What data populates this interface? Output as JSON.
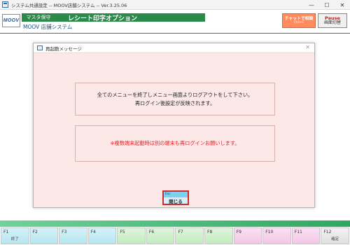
{
  "window": {
    "title": "システム共通設定 -- MOOV店舗システム -- Ver.3.25.06",
    "minimize_glyph": "—",
    "maximize_glyph": "☐",
    "close_glyph": "✕"
  },
  "header": {
    "logo_text": "MOOV",
    "master_label": "マスタ保守",
    "screen_title": "レシート印字オプション",
    "system_name": "MOOV 店舗システム",
    "chat_button": {
      "line1": "チャットで相談",
      "line2": "Ctrl+S"
    },
    "pause_button": {
      "line1": "Pause",
      "line2": "画面切替"
    }
  },
  "dialog": {
    "title": "再起動メッセージ",
    "close_glyph": "✕",
    "message_line1": "全てのメニューを終了しメニュー画面よりログアウトをして下さい。",
    "message_line2": "再ログイン後設定が反映されます。",
    "warning": "※複数端末起動時は別の端末も再ログインお願いします。",
    "close_button": {
      "key": "Esc",
      "label": "閉じる"
    }
  },
  "fkeys": [
    {
      "key": "F1",
      "label": "終了",
      "group": "blue"
    },
    {
      "key": "F2",
      "label": "",
      "group": "blue"
    },
    {
      "key": "F3",
      "label": "",
      "group": "blue"
    },
    {
      "key": "F4",
      "label": "",
      "group": "blue"
    },
    {
      "key": "F5",
      "label": "",
      "group": "green"
    },
    {
      "key": "F6",
      "label": "",
      "group": "green"
    },
    {
      "key": "F7",
      "label": "",
      "group": "green"
    },
    {
      "key": "F8",
      "label": "",
      "group": "green"
    },
    {
      "key": "F9",
      "label": "",
      "group": "pink"
    },
    {
      "key": "F10",
      "label": "",
      "group": "pink"
    },
    {
      "key": "F11",
      "label": "",
      "group": "pink"
    },
    {
      "key": "F12",
      "label": "確定",
      "group": "gray"
    }
  ]
}
